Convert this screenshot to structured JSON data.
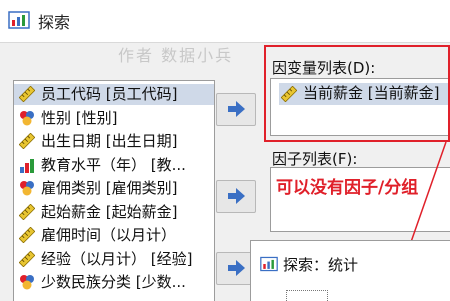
{
  "window": {
    "title": "探索"
  },
  "watermark": "作者  数据小兵",
  "variables": [
    {
      "label": "员工代码 [员工代码]",
      "icon": "ruler-icon",
      "selected": true
    },
    {
      "label": "性别 [性别]",
      "icon": "nominal-icon",
      "selected": false
    },
    {
      "label": "出生日期 [出生日期]",
      "icon": "ruler-icon",
      "selected": false
    },
    {
      "label": "教育水平（年） [教...",
      "icon": "ordinal-bar-icon",
      "selected": false
    },
    {
      "label": "雇佣类别 [雇佣类别]",
      "icon": "nominal-icon",
      "selected": false
    },
    {
      "label": "起始薪金 [起始薪金]",
      "icon": "ruler-icon",
      "selected": false
    },
    {
      "label": "雇佣时间（以月计）",
      "icon": "ruler-icon",
      "selected": false
    },
    {
      "label": "经验（以月计） [经验]",
      "icon": "ruler-icon",
      "selected": false
    },
    {
      "label": "少数民族分类 [少数...",
      "icon": "nominal-icon",
      "selected": false
    }
  ],
  "dependent": {
    "label": "因变量列表(D):",
    "items": [
      {
        "label": "当前薪金 [当前薪金]",
        "icon": "ruler-icon"
      }
    ]
  },
  "factor": {
    "label": "因子列表(F):",
    "annotation": "可以没有因子/分组"
  },
  "popup": {
    "title": "探索：统计"
  },
  "colors": {
    "annotation": "#e0202a",
    "arrow": "#3a6fc4",
    "selection": "#cfd9e8"
  }
}
